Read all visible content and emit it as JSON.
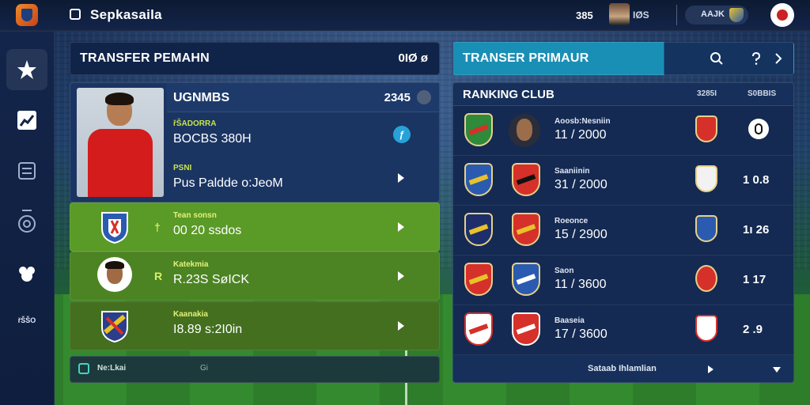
{
  "topbar": {
    "title": "Sepkasaila",
    "coins": "385",
    "stat": "IØS",
    "club_label": "AAJK"
  },
  "sidebar": {
    "items": [
      {
        "icon": "star-icon"
      },
      {
        "icon": "chart-icon"
      },
      {
        "icon": "list-icon"
      },
      {
        "icon": "scout-icon"
      },
      {
        "icon": "club-icon"
      }
    ],
    "bottom_label": "řŠŠO"
  },
  "transfer": {
    "title": "TRANSFER PEMAHN",
    "count": "0IØ ø",
    "card": {
      "name": "UGNMBS",
      "id": "2345",
      "label1": "řŠADORRA",
      "value1": "BOCBS 380H",
      "label2": "PSNI",
      "value2": "Pus Paldde o:JeoM",
      "info_glyph": "ƒ"
    },
    "rows": [
      {
        "small": "†",
        "label": "Tean sonsn",
        "value": "00 20 ssdos"
      },
      {
        "small": "R",
        "label": "Katekmia",
        "value": "R.23S SøICK"
      },
      {
        "small": "",
        "label": "Kaanakia",
        "value": "I8.89 s:2I0in"
      }
    ],
    "footer_label": "Ne:Lkai",
    "footer_sub": "Gi"
  },
  "ranking_header": {
    "title": "TRANSER PRIMAUR"
  },
  "ranking": {
    "title": "RANKING CLUB",
    "col1": "3285I",
    "col2": "S0BBIS",
    "rows": [
      {
        "label": "Aoosb:Nesniin",
        "value": "11 / 2000",
        "score": ""
      },
      {
        "label": "Saaniinin",
        "value": "31 / 2000",
        "score": "1 0.8"
      },
      {
        "label": "Roeonce",
        "value": "15 / 2900",
        "score": "1ı 26"
      },
      {
        "label": "Saon",
        "value": "11 / 3600",
        "score": "1 17"
      },
      {
        "label": "Baaseia",
        "value": "17 / 3600",
        "score": "2 .9"
      }
    ],
    "footer_label": "Sataab Ihlamlian"
  },
  "colors": {
    "accent": "#1a8fb5",
    "panel": "#17305b",
    "green_row": "#5a9a27",
    "crest_red": "#d6302a",
    "crest_blue": "#2a5bb0",
    "crest_yellow": "#e8c22a"
  }
}
